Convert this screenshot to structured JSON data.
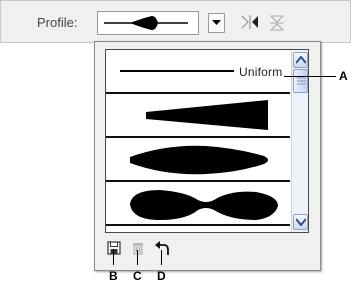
{
  "toolbar": {
    "profile_label": "Profile:"
  },
  "profile_list": {
    "items": [
      {
        "label": "Uniform",
        "shape": "uniform"
      },
      {
        "label": "",
        "shape": "wedge"
      },
      {
        "label": "",
        "shape": "lens"
      },
      {
        "label": "",
        "shape": "double-bulge"
      }
    ]
  },
  "bottom_icons": [
    "save-icon",
    "delete-icon",
    "reset-icon"
  ],
  "callouts": {
    "a": "A",
    "b": "B",
    "c": "C",
    "d": "D"
  },
  "colors": {
    "toolbar_bg": "#f0f0ee",
    "scroll_accent": "#8aa3cd",
    "shape_fill": "#000000"
  }
}
